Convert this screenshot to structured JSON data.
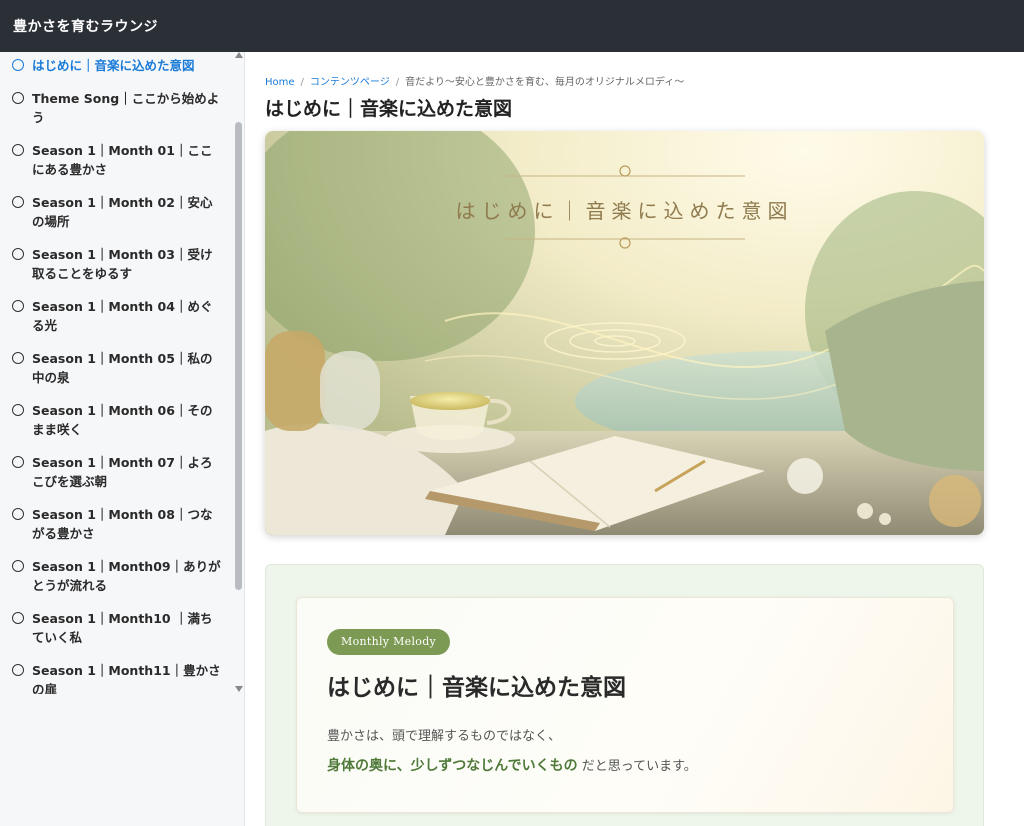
{
  "header": {
    "site_title": "豊かさを育むラウンジ"
  },
  "sidebar": {
    "items": [
      {
        "label": "はじめに｜音楽に込めた意図",
        "active": true
      },
      {
        "label": "Theme Song｜ここから始めよう"
      },
      {
        "label": "Season 1｜Month 01｜ここにある豊かさ"
      },
      {
        "label": "Season 1｜Month 02｜安心の場所"
      },
      {
        "label": "Season 1｜Month 03｜受け取ることをゆるす"
      },
      {
        "label": "Season 1｜Month 04｜めぐる光"
      },
      {
        "label": "Season 1｜Month 05｜私の中の泉"
      },
      {
        "label": "Season 1｜Month 06｜そのまま咲く"
      },
      {
        "label": "Season 1｜Month 07｜よろこびを選ぶ朝"
      },
      {
        "label": "Season 1｜Month 08｜つながる豊かさ"
      },
      {
        "label": "Season 1｜Month09｜ありがとうが流れる"
      },
      {
        "label": "Season 1｜Month10 ｜満ちていく私"
      },
      {
        "label": "Season 1｜Month11｜豊かさの扉"
      }
    ]
  },
  "breadcrumb": {
    "home": "Home",
    "section": "コンテンツページ",
    "current": "音だより〜安心と豊かさを育む、毎月のオリジナルメロディ〜",
    "separator": "/"
  },
  "page": {
    "title": "はじめに｜音楽に込めた意図"
  },
  "hero": {
    "title": "はじめに｜音楽に込めた意図"
  },
  "card": {
    "badge": "Monthly Melody",
    "title": "はじめに｜音楽に込めた意図",
    "line1": "豊かさは、頭で理解するものではなく、",
    "line2_emphasis": "身体の奥に、少しずつなじんでいくもの",
    "line2_rest": "だと思っています。"
  },
  "colors": {
    "topbar": "#2b2f36",
    "active": "#1a7bd8",
    "badge": "#7d9a55",
    "emphasis": "#4f7a3a"
  }
}
